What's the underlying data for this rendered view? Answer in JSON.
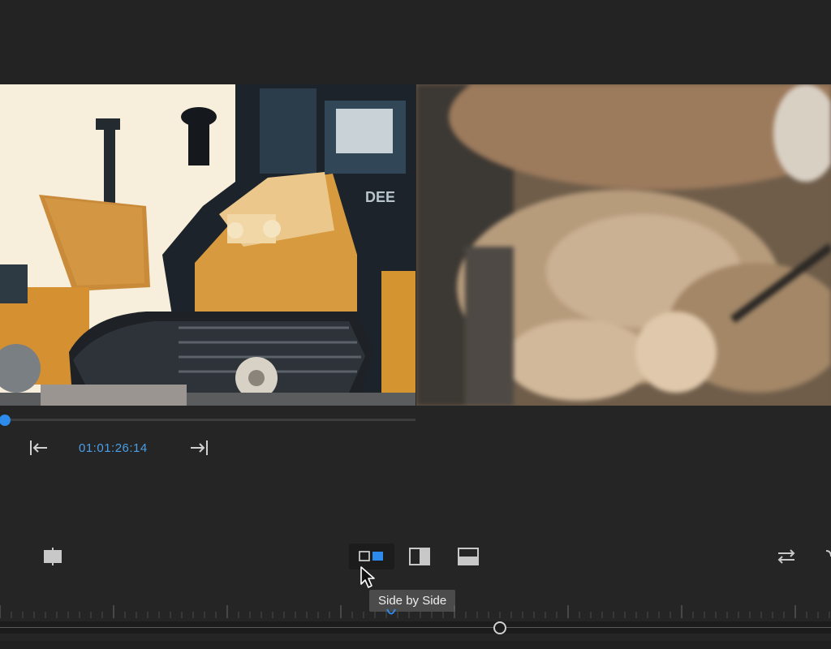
{
  "viewer": {
    "left_clip": "bulldozer-footage",
    "right_clip": "craft-closeup-footage"
  },
  "transport": {
    "timecode": "01:01:26:14",
    "progress_fraction": 0.01,
    "mark_in_icon": "go-to-in-icon",
    "mark_out_icon": "go-to-out-icon"
  },
  "compare_controls": {
    "split_icon": "split-view-icon",
    "side_by_side_icon": "side-by-side-icon",
    "vertical_split_icon": "vertical-split-icon",
    "horizontal_split_icon": "horizontal-split-icon",
    "swap_icon": "swap-sides-icon",
    "active_mode": "Side by Side"
  },
  "tooltip": {
    "text": "Side by Side"
  },
  "colors": {
    "accent": "#2d8ceb",
    "background": "#252525",
    "timecode": "#4a9fe8"
  }
}
